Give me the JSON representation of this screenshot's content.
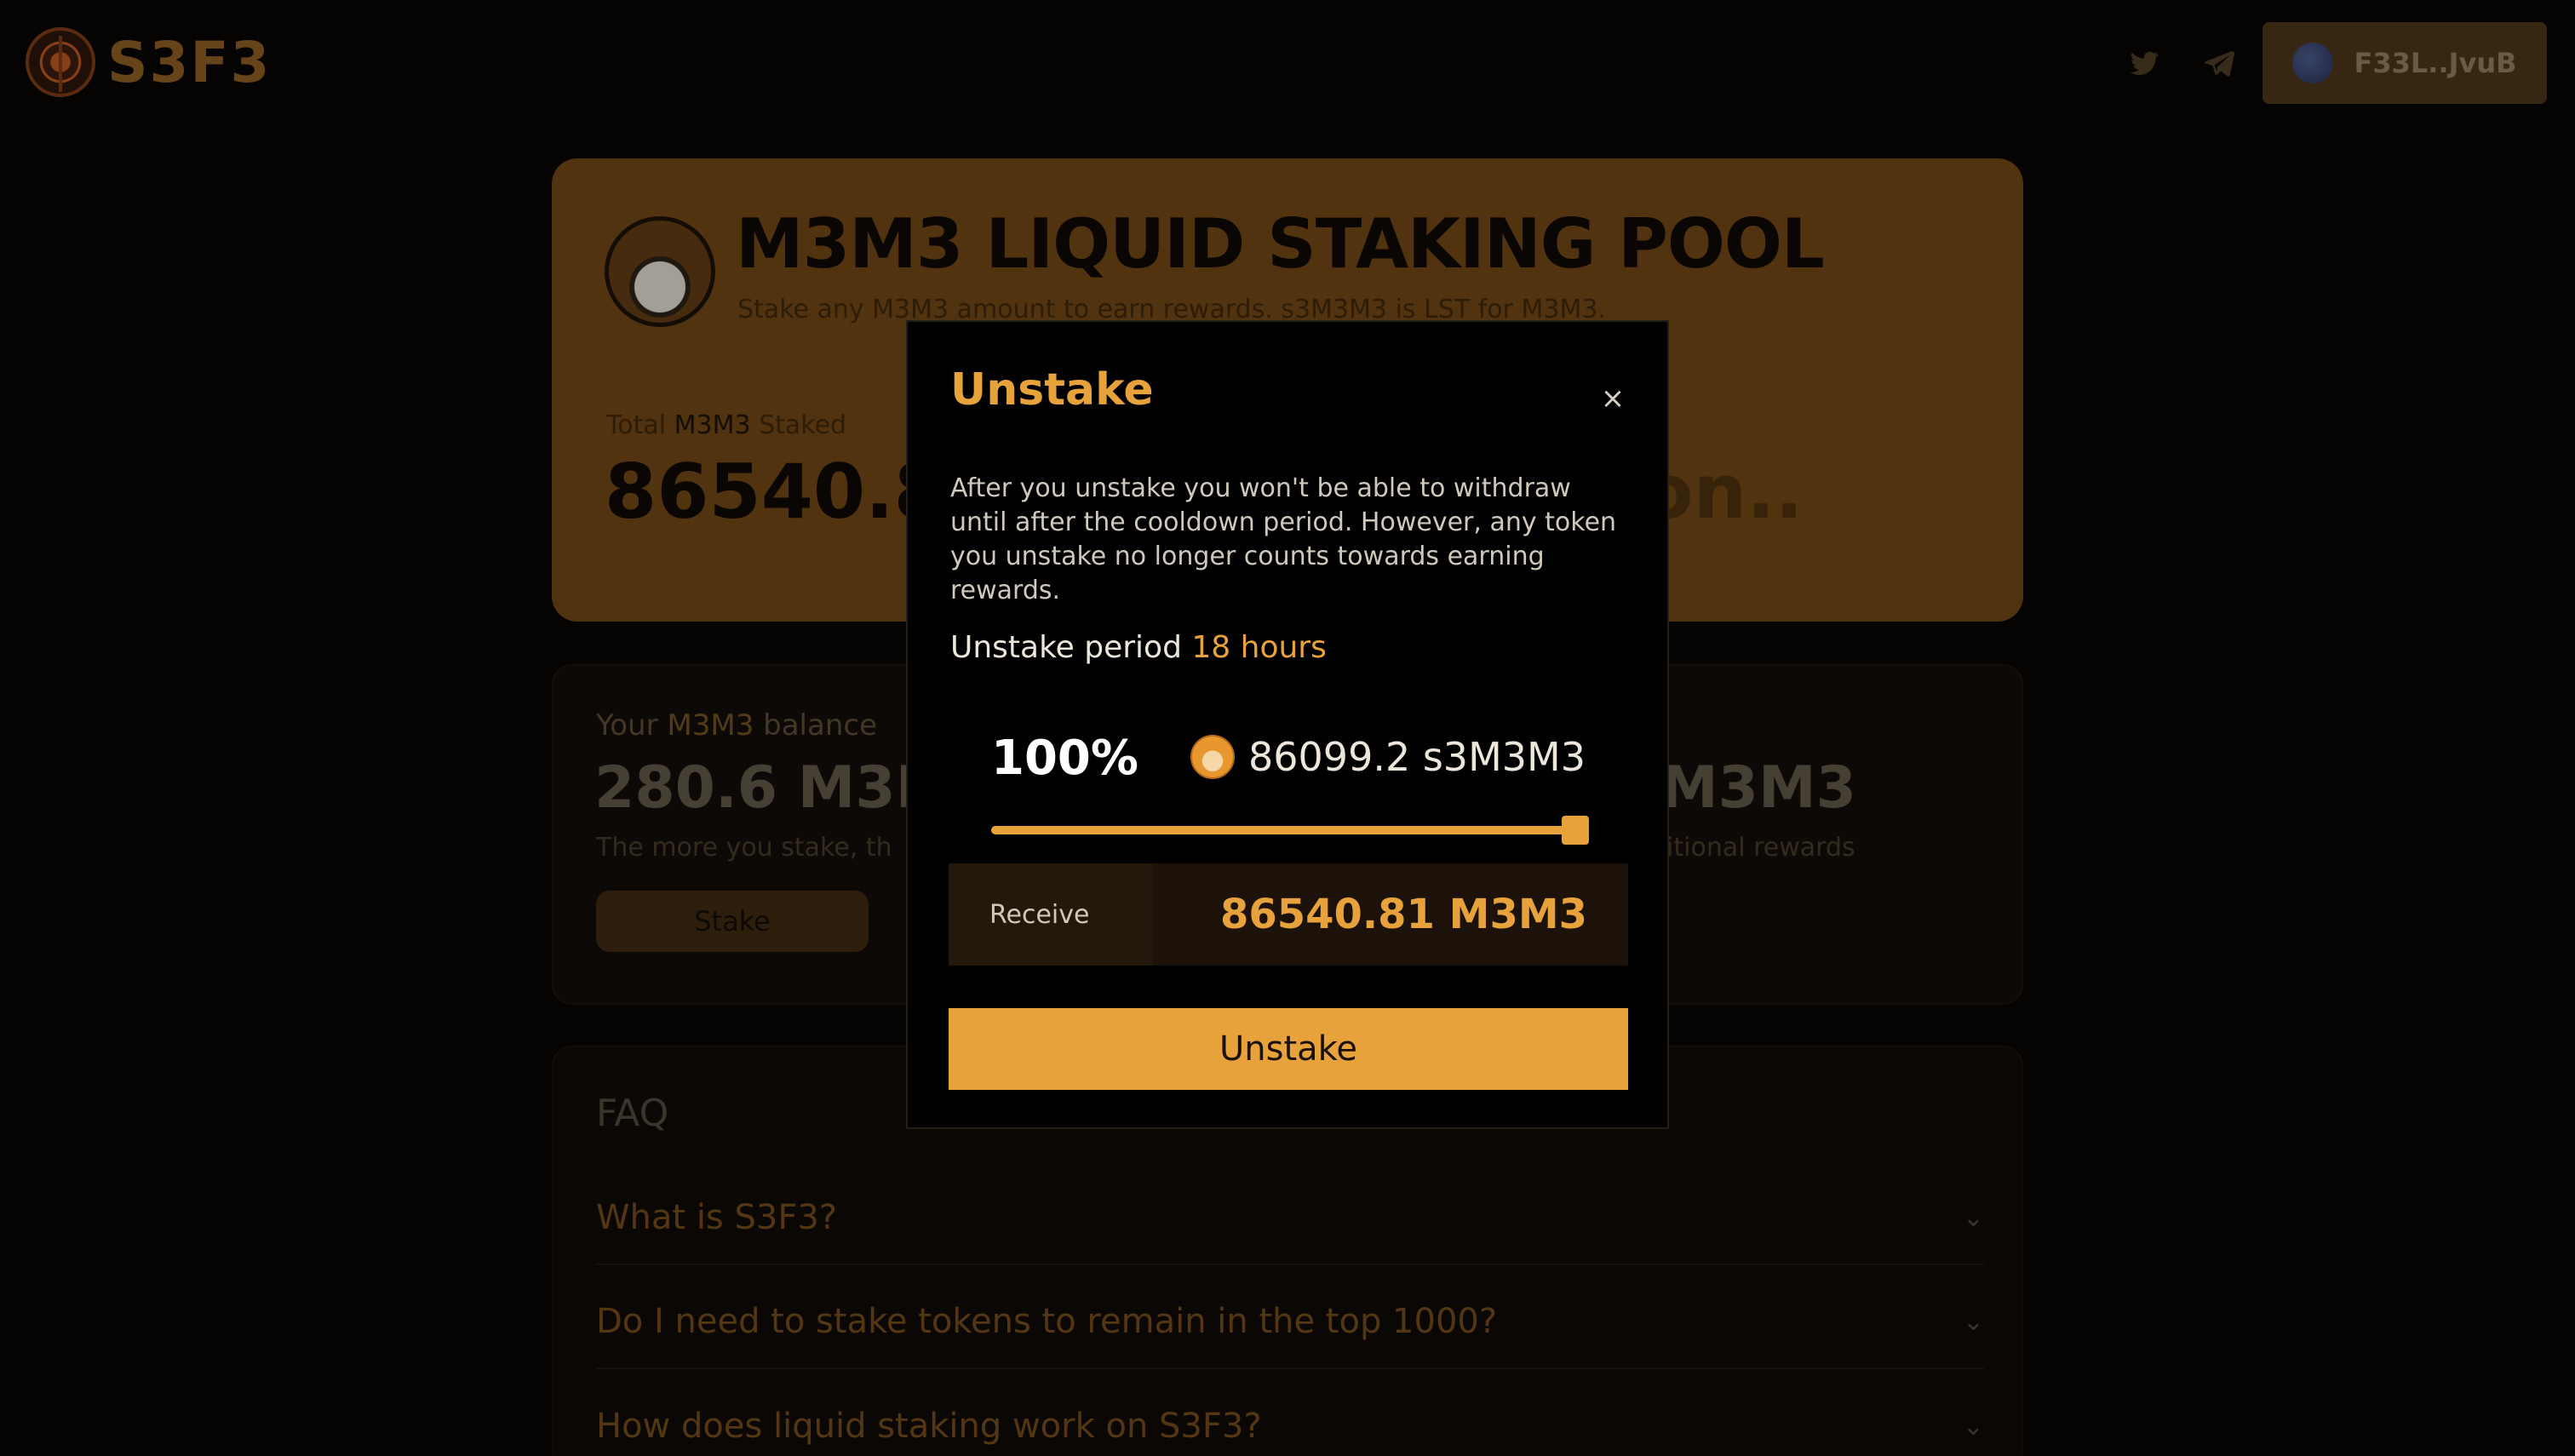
{
  "header": {
    "logo_text": "S3F3",
    "wallet_label": "F33L..JvuB"
  },
  "pool": {
    "title": "M3M3 LIQUID STAKING POOL",
    "subtitle": "Stake any M3M3 amount to earn rewards. s3M3M3 is LST for M3M3.",
    "stat_label_prefix": "Total ",
    "stat_label_token": "M3M3",
    "stat_label_suffix": " Staked",
    "stat_value": "86540.8",
    "stat_right_value": "on.."
  },
  "balance": {
    "label_prefix": "Your ",
    "label_token": "M3M3",
    "label_suffix": " balance",
    "value": "280.6 M3M",
    "note": "The more you stake, th",
    "right_label": "e",
    "right_value": "M3M3",
    "right_note": "ditional rewards",
    "stake_button": "Stake"
  },
  "faq": {
    "title": "FAQ",
    "items": [
      {
        "question": "What is S3F3?"
      },
      {
        "question": "Do I need to stake tokens to remain in the top 1000?"
      },
      {
        "question": "How does liquid staking work on S3F3?"
      }
    ]
  },
  "modal": {
    "title": "Unstake",
    "close_symbol": "×",
    "description": "After you unstake you won't be able to withdraw until after the cooldown period. However, any token you unstake no longer counts towards earning rewards.",
    "period_label": "Unstake period",
    "period_value": "18 hours",
    "percent_label": "100%",
    "slider_value": 1.0,
    "token_amount": "86099.2 s3M3M3",
    "receive_label": "Receive",
    "receive_value": "86540.81 M3M3",
    "unstake_button": "Unstake"
  },
  "colors": {
    "accent": "#e7a23c",
    "background": "#070605"
  },
  "icons": {
    "twitter": "twitter-icon",
    "telegram": "telegram-icon",
    "close": "close-icon",
    "chevron": "chevron-down-icon"
  }
}
